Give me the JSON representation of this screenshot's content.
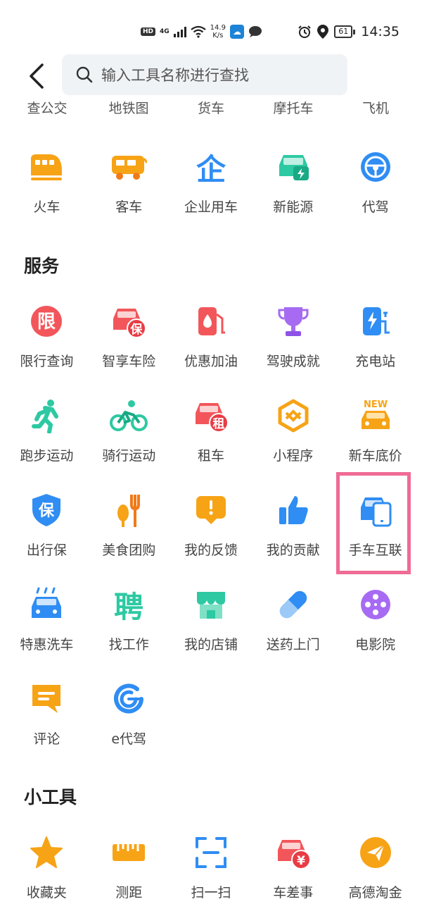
{
  "status_bar": {
    "hd": "HD",
    "signal": "4G",
    "net_speed_value": "14.9",
    "net_speed_unit": "K/s",
    "battery": "61",
    "time": "14:35"
  },
  "header": {
    "search_placeholder": "输入工具名称进行查找"
  },
  "transport_partial": [
    "查公交",
    "地铁图",
    "货车",
    "摩托车",
    "飞机"
  ],
  "transport": [
    "火车",
    "客车",
    "企业用车",
    "新能源",
    "代驾"
  ],
  "services": {
    "title": "服务",
    "items": [
      "限行查询",
      "智享车险",
      "优惠加油",
      "驾驶成就",
      "充电站",
      "跑步运动",
      "骑行运动",
      "租车",
      "小程序",
      "新车底价",
      "出行保",
      "美食团购",
      "我的反馈",
      "我的贡献",
      "手车互联",
      "特惠洗车",
      "找工作",
      "我的店铺",
      "送药上门",
      "电影院",
      "评论",
      "e代驾"
    ]
  },
  "tools": {
    "title": "小工具",
    "items": [
      "收藏夹",
      "测距",
      "扫一扫",
      "车差事",
      "高德淘金"
    ]
  },
  "icon_glyphs": {
    "limit": "限",
    "insurance": "保",
    "rent": "租",
    "new": "NEW",
    "enterprise": "企",
    "hire": "聘",
    "yen": "¥"
  },
  "colors": {
    "accent_orange": "#f7a316",
    "accent_blue": "#2f8df3",
    "accent_red": "#f2565a",
    "accent_teal": "#2dc9a2",
    "highlight_pink": "#f06b96"
  }
}
